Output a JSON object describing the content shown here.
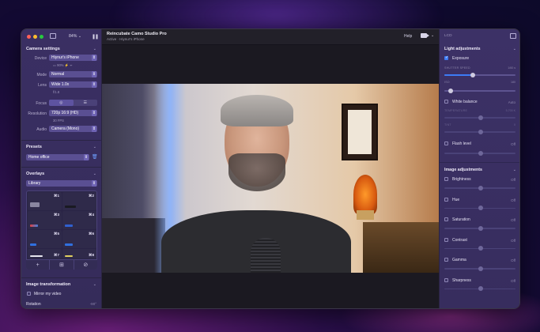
{
  "window": {
    "zoom": "84%",
    "app_title": "Reincubate Camo Studio Pro",
    "app_subtitle": "Active · Hiynur's iPhone",
    "help_label": "Help"
  },
  "camera_settings": {
    "title": "Camera settings",
    "device_label": "Device",
    "device_value": "Hiynur's iPhone",
    "device_status": "90%",
    "mode_label": "Mode",
    "mode_value": "Normal",
    "lens_label": "Lens",
    "lens_value": "Wide 1.0x",
    "lens_sub": "f/1.8",
    "focus_label": "Focus",
    "resolution_label": "Resolution",
    "resolution_value": "720p 16:9 (HD)",
    "resolution_sub": "30 FPS",
    "audio_label": "Audio",
    "audio_value": "Camera (Mono)"
  },
  "presets": {
    "title": "Presets",
    "value": "Home office"
  },
  "overlays": {
    "title": "Overlays",
    "library_value": "Library",
    "cells": [
      {
        "key": "⌘1"
      },
      {
        "key": "⌘2"
      },
      {
        "key": "⌘3"
      },
      {
        "key": "⌘4"
      },
      {
        "key": "⌘5"
      },
      {
        "key": "⌘6"
      },
      {
        "key": "⌘7"
      },
      {
        "key": "⌘8"
      }
    ]
  },
  "image_transformation": {
    "title": "Image transformation",
    "mirror_label": "Mirror my video",
    "rotation_label": "Rotation",
    "rotation_value": "-90°"
  },
  "light_adjustments": {
    "title": "Light adjustments",
    "exposure_label": "Exposure",
    "shutter_label": "SHUTTER SPEED",
    "shutter_value": "1/60 s",
    "iso_label": "ISO",
    "iso_value": "180",
    "shutter_level": 0.4,
    "iso_level": 0.06,
    "white_balance_label": "White balance",
    "white_balance_value": "Auto",
    "temperature_label": "TEMPERATURE",
    "temperature_value": "5,700 K",
    "tint_label": "TINT",
    "tint_value": "0",
    "flash_label": "Flash level",
    "flash_value": "Off"
  },
  "image_adjustments": {
    "title": "Image adjustments",
    "items": [
      {
        "label": "Brightness",
        "value": "Off"
      },
      {
        "label": "Hue",
        "value": "Off"
      },
      {
        "label": "Saturation",
        "value": "Off"
      },
      {
        "label": "Contrast",
        "value": "Off"
      },
      {
        "label": "Gamma",
        "value": "Off"
      },
      {
        "label": "Sharpness",
        "value": "Off"
      }
    ]
  },
  "right_panel": {
    "lcd_label": "LCD"
  }
}
